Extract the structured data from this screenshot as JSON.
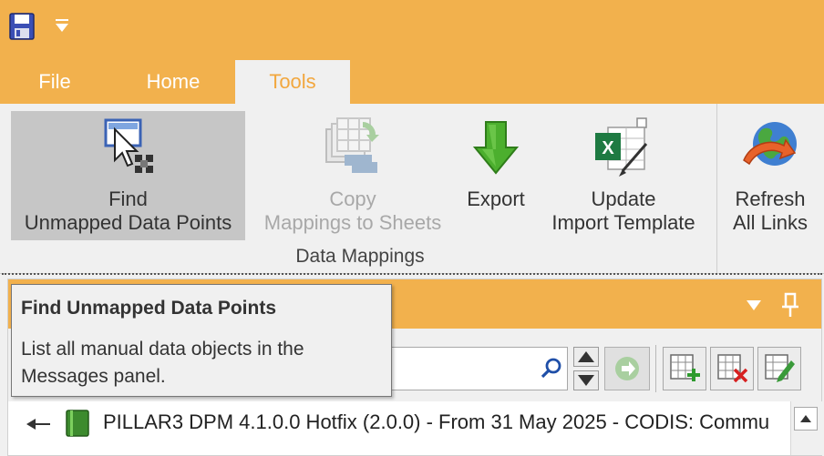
{
  "qat": {
    "save_icon": "floppy-save-icon",
    "customize_icon": "dropdown-arrow-icon"
  },
  "tabs": [
    {
      "label": "File",
      "active": false
    },
    {
      "label": "Home",
      "active": false
    },
    {
      "label": "Tools",
      "active": true
    }
  ],
  "ribbon": {
    "buttons": [
      {
        "line1": "Find",
        "line2": "Unmapped Data Points",
        "icon": "find-unmapped-icon",
        "state": "pressed"
      },
      {
        "line1": "Copy",
        "line2": "Mappings to Sheets",
        "icon": "copy-mappings-icon",
        "state": "disabled"
      },
      {
        "line1": "Export",
        "line2": "",
        "icon": "export-arrow-icon",
        "state": "normal"
      },
      {
        "line1": "Update",
        "line2": "Import Template",
        "icon": "excel-update-icon",
        "state": "normal"
      },
      {
        "line1": "Refresh",
        "line2": "All Links",
        "icon": "globe-refresh-icon",
        "state": "normal"
      }
    ],
    "group_label": "Data Mappings"
  },
  "panel": {
    "search": {
      "value": "",
      "placeholder": ""
    },
    "tree": {
      "item": "PILLAR3 DPM 4.1.0.0 Hotfix (2.0.0) - From 31 May 2025 - CODIS: Commu"
    }
  },
  "tooltip": {
    "title": "Find Unmapped Data Points",
    "body": "List all manual data objects in the Messages panel."
  },
  "colors": {
    "accent": "#f2b14d",
    "tab_active_text": "#f2a73e",
    "ribbon_bg": "#f0f0f0",
    "pressed_bg": "#c6c6c6"
  }
}
